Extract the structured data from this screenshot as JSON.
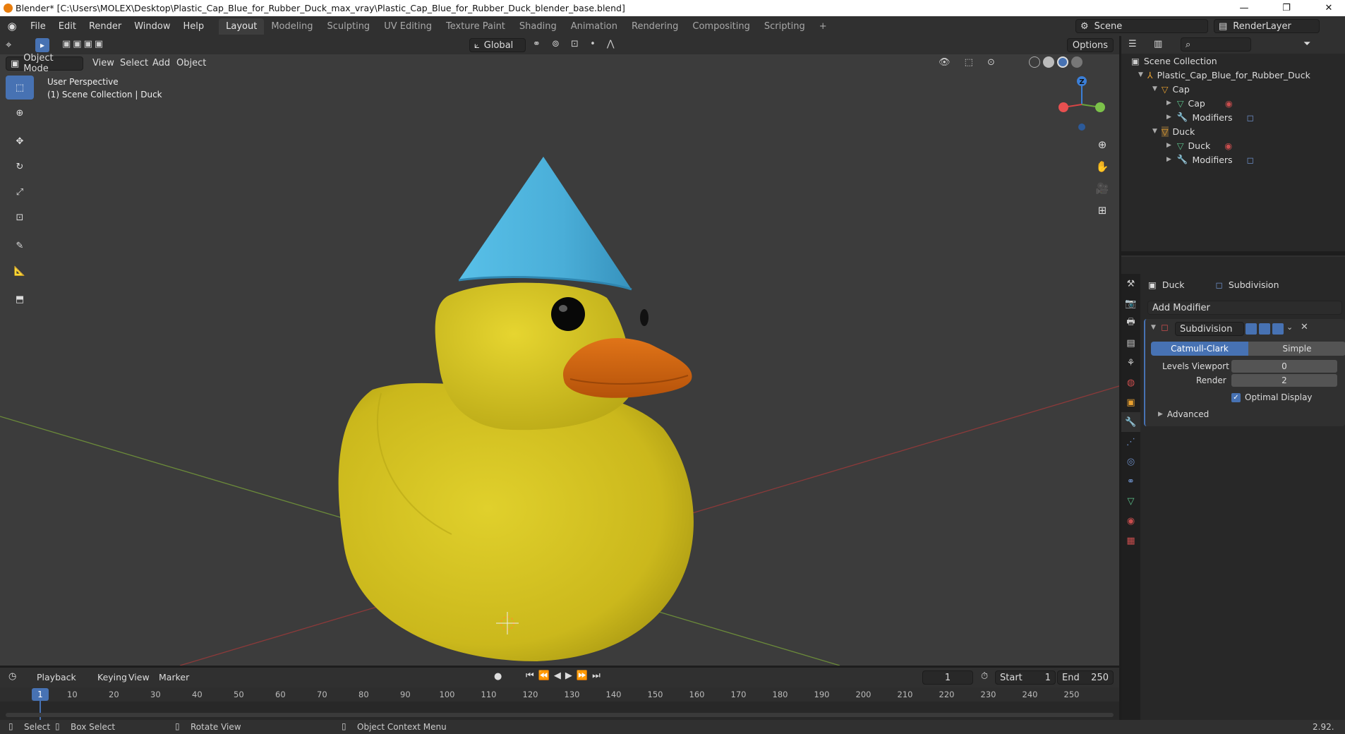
{
  "window": {
    "title": "Blender* [C:\\Users\\MOLEX\\Desktop\\Plastic_Cap_Blue_for_Rubber_Duck_max_vray\\Plastic_Cap_Blue_for_Rubber_Duck_blender_base.blend]",
    "minimize": "—",
    "restore": "❐",
    "close": "✕"
  },
  "menu": [
    "File",
    "Edit",
    "Render",
    "Window",
    "Help"
  ],
  "workspaces": [
    "Layout",
    "Modeling",
    "Sculpting",
    "UV Editing",
    "Texture Paint",
    "Shading",
    "Animation",
    "Rendering",
    "Compositing",
    "Scripting",
    "+"
  ],
  "scene": {
    "label": "Scene",
    "layer": "RenderLayer"
  },
  "viewport_header": {
    "orientation": "Global",
    "options": "Options",
    "mode": "Object Mode",
    "menus": [
      "View",
      "Select",
      "Add",
      "Object"
    ]
  },
  "viewport": {
    "perspective": "User Perspective",
    "collection": "(1) Scene Collection | Duck",
    "gizmo_z": "Z"
  },
  "outliner": {
    "root": "Scene Collection",
    "collection": "Plastic_Cap_Blue_for_Rubber_Duck",
    "items": [
      {
        "name": "Cap",
        "level": 1
      },
      {
        "name": "Cap",
        "level": 2
      },
      {
        "name": "Modifiers",
        "level": 2
      },
      {
        "name": "Duck",
        "level": 1
      },
      {
        "name": "Duck",
        "level": 2
      },
      {
        "name": "Modifiers",
        "level": 2
      }
    ]
  },
  "properties": {
    "object": "Duck",
    "modifier_crumb": "Subdivision",
    "add_modifier": "Add Modifier",
    "modifier_name": "Subdivision",
    "algo_catmull": "Catmull-Clark",
    "algo_simple": "Simple",
    "levels_viewport_label": "Levels Viewport",
    "levels_viewport": "0",
    "render_label": "Render",
    "render": "2",
    "optimal_display": "Optimal Display",
    "advanced": "Advanced"
  },
  "timeline": {
    "menus": [
      "Playback",
      "Keying",
      "View",
      "Marker"
    ],
    "current_frame": "1",
    "start_label": "Start",
    "start": "1",
    "end_label": "End",
    "end": "250",
    "ticks": [
      "10",
      "20",
      "30",
      "40",
      "50",
      "60",
      "70",
      "80",
      "90",
      "100",
      "110",
      "120",
      "130",
      "140",
      "150",
      "160",
      "170",
      "180",
      "190",
      "200",
      "210",
      "220",
      "230",
      "240",
      "250"
    ]
  },
  "status": {
    "select": "Select",
    "box_select": "Box Select",
    "rotate": "Rotate View",
    "context": "Object Context Menu",
    "version": "2.92."
  },
  "colors": {
    "accent": "#4772b3",
    "cap": "#4fb2dc",
    "duck": "#d3c31e",
    "beak": "#d4650f"
  }
}
